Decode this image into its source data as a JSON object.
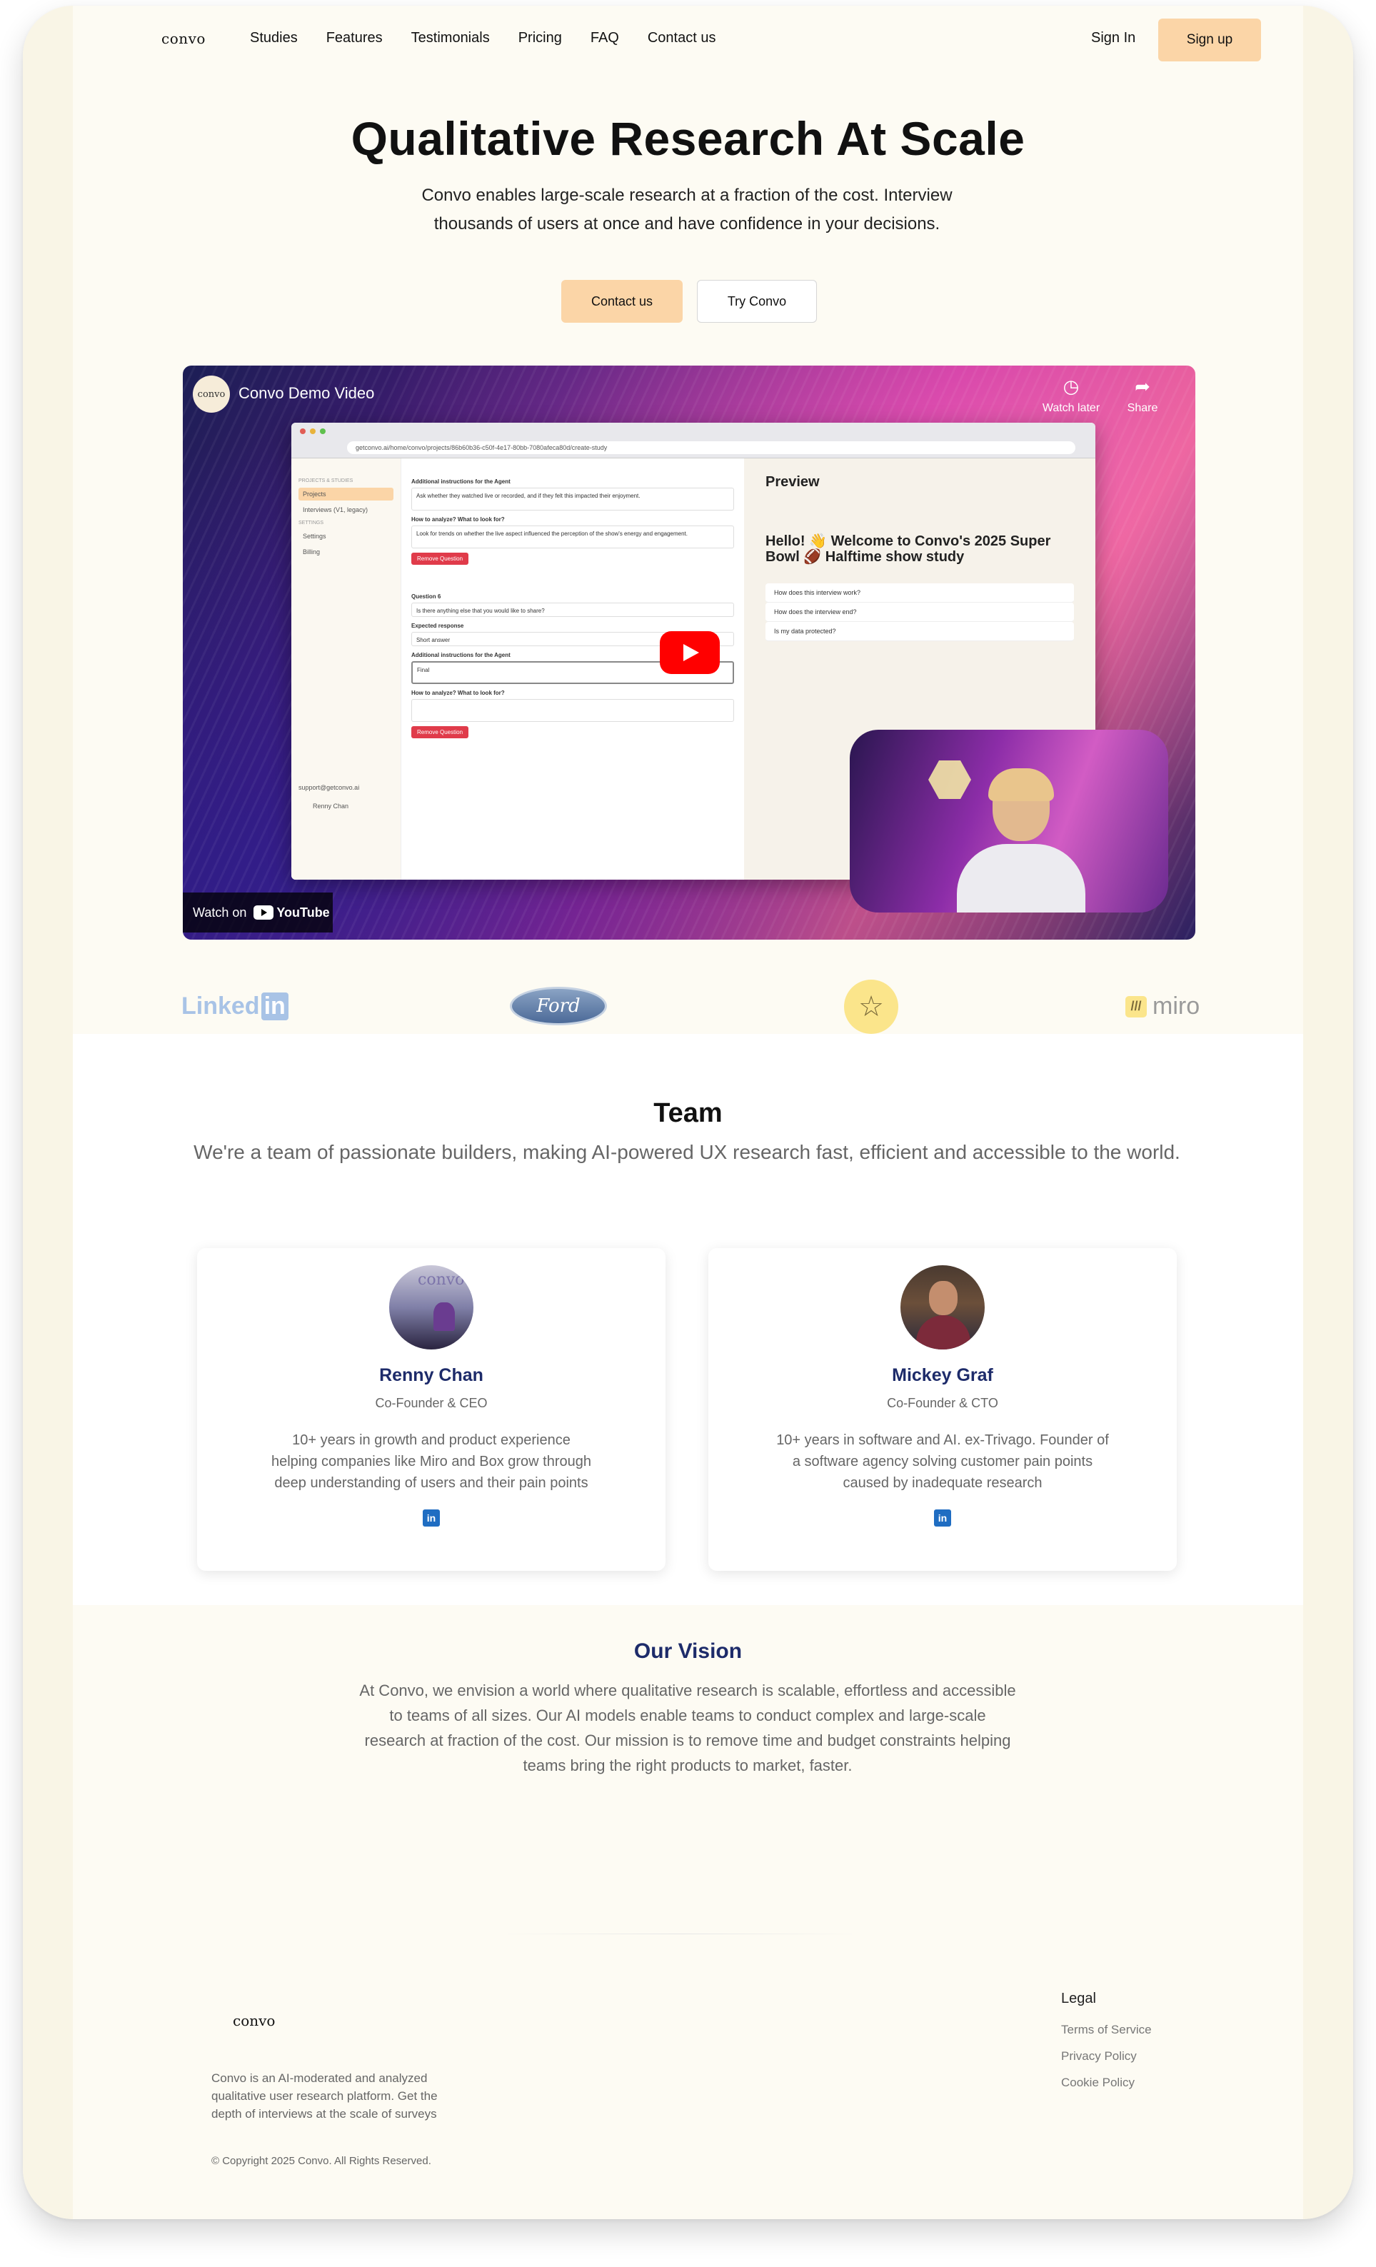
{
  "nav": {
    "logo": "convo",
    "links": [
      "Studies",
      "Features",
      "Testimonials",
      "Pricing",
      "FAQ",
      "Contact us"
    ],
    "sign_in": "Sign In",
    "sign_up": "Sign up"
  },
  "hero": {
    "title": "Qualitative Research At Scale",
    "subtitle": "Convo enables large-scale research at a fraction of the cost. Interview thousands of users at once and have confidence in your decisions.",
    "contact_button": "Contact us",
    "try_button": "Try Convo"
  },
  "video": {
    "channel_avatar": "convo",
    "title": "Convo Demo Video",
    "watch_later": "Watch later",
    "share": "Share",
    "watch_on": "Watch on",
    "youtube": "YouTube",
    "app_url": "getconvo.ai/home/convo/projects/86b60b36-c50f-4e17-80bb-7080afeca80d/create-study",
    "app_sidebar": {
      "section_projects": "PROJECTS & STUDIES",
      "item_projects": "Projects",
      "item_interviews": "Interviews (V1, legacy)",
      "section_settings": "SETTINGS",
      "item_settings": "Settings",
      "item_billing": "Billing",
      "support": "support@getconvo.ai",
      "user": "Renny Chan"
    },
    "app_main": {
      "label_instructions": "Additional instructions for the Agent",
      "text_instructions": "Ask whether they watched live or recorded, and if they felt this impacted their enjoyment.",
      "label_analyze": "How to analyze? What to look for?",
      "text_analyze": "Look for trends on whether the live aspect influenced the perception of the show's energy and engagement.",
      "remove": "Remove Question",
      "label_q6": "Question 6",
      "text_q6": "Is there anything else that you would like to share?",
      "label_expected": "Expected response",
      "text_expected": "Short answer",
      "text_final": "Final"
    },
    "preview": {
      "title": "Preview",
      "heading": "Hello! 👋 Welcome to Convo's 2025 Super Bowl 🏈 Halftime show study",
      "q1": "How does this interview work?",
      "q2": "How does the interview end?",
      "q3": "Is my data protected?"
    }
  },
  "logos": [
    "LinkedIn",
    "Ford",
    "star-logo-icon",
    "miro"
  ],
  "team": {
    "title": "Team",
    "subtitle": "We're a team of passionate builders, making AI-powered UX research fast, efficient and accessible to the world.",
    "members": [
      {
        "name": "Renny Chan",
        "role": "Co-Founder & CEO",
        "bio": "10+ years in growth and product experience helping companies like Miro and Box grow through deep understanding of users and their pain points"
      },
      {
        "name": "Mickey Graf",
        "role": "Co-Founder & CTO",
        "bio": "10+ years in software and AI. ex-Trivago. Founder of a software agency solving customer pain points caused by inadequate research"
      }
    ]
  },
  "vision": {
    "title": "Our Vision",
    "body": "At Convo, we envision a world where qualitative research is scalable, effortless and accessible to teams of all sizes. Our AI models enable teams to conduct complex and large-scale research at fraction of the cost. Our mission is to remove time and budget constraints helping teams bring the right products to market, faster."
  },
  "footer": {
    "logo": "convo",
    "description": "Convo is an AI-moderated and analyzed qualitative user research platform. Get the depth of interviews at the scale of surveys",
    "copyright": "© Copyright 2025 Convo. All Rights Reserved.",
    "legal_heading": "Legal",
    "legal_links": [
      "Terms of Service",
      "Privacy Policy",
      "Cookie Policy"
    ]
  },
  "colors": {
    "accent": "#fbd5a7",
    "page_bg": "#fdfbf3",
    "name_color": "#1d2b6a",
    "youtube_red": "#ff0000"
  }
}
